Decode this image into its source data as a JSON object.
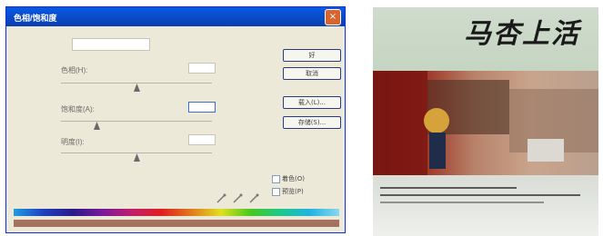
{
  "dialog": {
    "title": "色相/饱和度",
    "close_label": "×",
    "edit_value": "",
    "fields": [
      {
        "label": "色相(H):",
        "value": ""
      },
      {
        "label": "饱和度(A):",
        "value": ""
      },
      {
        "label": "明度(I):",
        "value": ""
      }
    ],
    "buttons": {
      "ok": "好",
      "cancel": "取消",
      "load": "载入(L)...",
      "save": "存储(S)..."
    },
    "checkboxes": {
      "colorize": "着色(O)",
      "preview": "预览(P)"
    }
  },
  "cover": {
    "title": "马杏上活"
  }
}
